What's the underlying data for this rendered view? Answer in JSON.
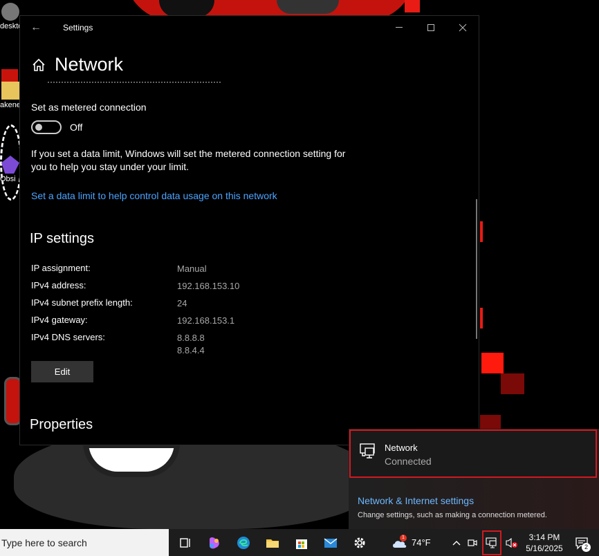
{
  "window": {
    "title": "Settings",
    "back_icon": "←"
  },
  "page": {
    "title": "Network"
  },
  "metered": {
    "label": "Set as metered connection",
    "state": "Off",
    "info": "If you set a data limit, Windows will set the metered connection setting for you to help you stay under your limit.",
    "link": "Set a data limit to help control data usage on this network"
  },
  "ip_settings": {
    "title": "IP settings",
    "rows": [
      {
        "key": "IP assignment:",
        "value": "Manual"
      },
      {
        "key": "IPv4 address:",
        "value": "192.168.153.10"
      },
      {
        "key": "IPv4 subnet prefix length:",
        "value": "24"
      },
      {
        "key": "IPv4 gateway:",
        "value": "192.168.153.1"
      },
      {
        "key": "IPv4 DNS servers:",
        "value": "8.8.8.8",
        "value2": "8.8.4.4"
      }
    ],
    "edit_label": "Edit"
  },
  "properties": {
    "title": "Properties"
  },
  "flyout": {
    "network_name": "Network",
    "network_status": "Connected",
    "settings_link": "Network & Internet settings",
    "settings_sub": "Change settings, such as making a connection metered."
  },
  "desktop_icons": {
    "desktop": "deskto",
    "folder": "akene",
    "obsidian": "Obsi"
  },
  "taskbar": {
    "search_placeholder": "Type here to search",
    "weather_temp": "74°F",
    "weather_badge": "1",
    "time": "3:14 PM",
    "date": "5/16/2025",
    "notification_count": "2",
    "chevron": "^"
  },
  "colors": {
    "accent_link": "#4ca4ff",
    "highlight_border": "#d01a20",
    "window_bg": "#000000"
  }
}
